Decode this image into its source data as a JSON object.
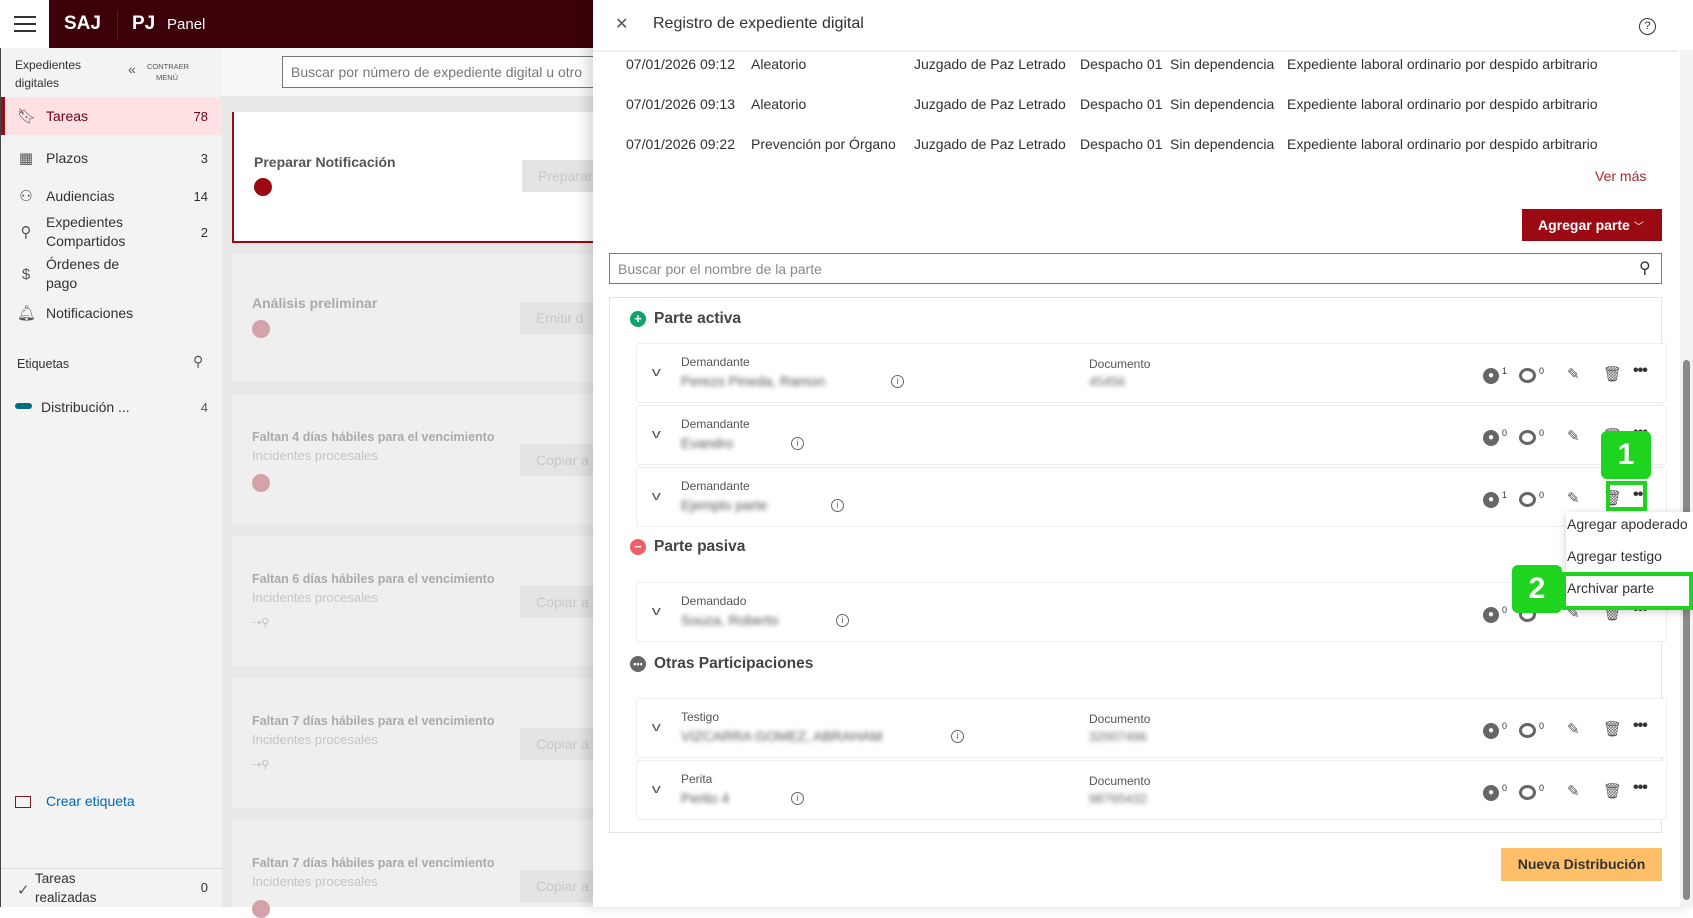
{
  "topbar": {
    "brand": "SAJ",
    "org": "PJ",
    "section": "Panel"
  },
  "sidebar": {
    "title": "Expedientes digitales",
    "collapse": "CONTRAER MENÚ",
    "items": [
      {
        "label": "Tareas",
        "count": "78",
        "icon": "bookmark-icon"
      },
      {
        "label": "Plazos",
        "count": "3",
        "icon": "calendar-icon"
      },
      {
        "label": "Audiencias",
        "count": "14",
        "icon": "people-icon"
      },
      {
        "label": "Expedientes Compartidos",
        "count": "2",
        "icon": "share-user-icon"
      },
      {
        "label": "Órdenes de pago",
        "count": "",
        "icon": "dollar-icon"
      },
      {
        "label": "Notificaciones",
        "count": "",
        "icon": "bell-icon"
      }
    ],
    "tags_title": "Etiquetas",
    "tags": [
      {
        "label": "Distribución ...",
        "count": "4",
        "color": "#006e82"
      }
    ],
    "create_tag": "Crear etiqueta",
    "done": {
      "label": "Tareas realizadas",
      "count": "0"
    }
  },
  "main": {
    "search_placeholder": "Buscar por número de expediente digital u otro",
    "tasks": [
      {
        "title": "Preparar Notificación",
        "sub": "",
        "button": "Preparar"
      },
      {
        "title": "Análisis preliminar",
        "sub": "",
        "button": "Emitir d"
      },
      {
        "title": "Faltan 4 días hábiles para el vencimiento",
        "sub": "Incidentes procesales",
        "button": "Copiar a"
      },
      {
        "title": "Faltan 6 días hábiles para el vencimiento",
        "sub": "Incidentes procesales",
        "button": "Copiar a"
      },
      {
        "title": "Faltan 7 días hábiles para el vencimiento",
        "sub": "Incidentes procesales",
        "button": "Copiar a"
      },
      {
        "title": "Faltan 7 días hábiles para el vencimiento",
        "sub": "Incidentes procesales",
        "button": "Copiar a"
      }
    ]
  },
  "drawer": {
    "title": "Registro de expediente digital",
    "history": [
      [
        "07/01/2026 09:12",
        "Aleatorio",
        "Juzgado de Paz Letrado",
        "Despacho 01",
        "Sin dependencia",
        "Expediente laboral ordinario por despido arbitrario"
      ],
      [
        "07/01/2026 09:13",
        "Aleatorio",
        "Juzgado de Paz Letrado",
        "Despacho 01",
        "Sin dependencia",
        "Expediente laboral ordinario por despido arbitrario"
      ],
      [
        "07/01/2026 09:22",
        "Prevención por Órgano",
        "Juzgado de Paz Letrado",
        "Despacho 01",
        "Sin dependencia",
        "Expediente laboral ordinario por despido arbitrario"
      ]
    ],
    "ver_mas": "Ver más",
    "add_party": "Agregar parte",
    "party_search_placeholder": "Buscar por el nombre de la parte",
    "doc_label": "Documento",
    "sections": [
      {
        "title": "Parte activa",
        "color": "#10a36b"
      },
      {
        "title": "Parte pasiva",
        "color": "#f25c68"
      },
      {
        "title": "Otras Participaciones",
        "color": "#666666"
      }
    ],
    "parties": [
      {
        "role": "Demandante",
        "name": "Perezs Pineda, Ramon",
        "doc": "45456",
        "persons": "1",
        "comments": "0"
      },
      {
        "role": "Demandante",
        "name": "Evandro",
        "doc": "",
        "persons": "0",
        "comments": "0"
      },
      {
        "role": "Demandante",
        "name": "Ejemplo parte",
        "doc": "",
        "persons": "1",
        "comments": "0"
      },
      {
        "role": "Demandado",
        "name": "Souza, Roberto",
        "doc": "",
        "persons": "0",
        "comments": "0"
      },
      {
        "role": "Testigo",
        "name": "VIZCARRA GOMEZ, ABRAHAM",
        "doc": "32007496",
        "persons": "0",
        "comments": "0"
      },
      {
        "role": "Perita",
        "name": "Perito 4",
        "doc": "98765432",
        "persons": "0",
        "comments": "0"
      }
    ],
    "menu": [
      "Agregar apoderado",
      "Agregar testigo",
      "Archivar parte"
    ],
    "new_distribution": "Nueva Distribución",
    "annotations": [
      "1",
      "2"
    ]
  }
}
